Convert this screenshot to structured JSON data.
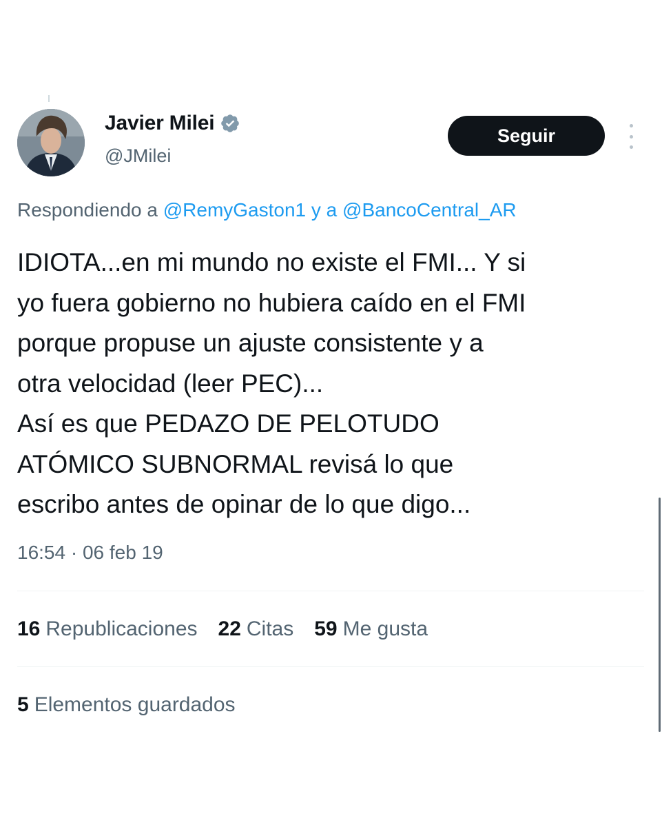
{
  "author": {
    "display_name": "Javier Milei",
    "handle": "@JMilei",
    "verified_color": "#829aab"
  },
  "actions": {
    "follow_label": "Seguir",
    "more_icon": "more-vertical-icon"
  },
  "reply_context": {
    "prefix": "Respondiendo a ",
    "mention_1": "@RemyGaston1",
    "joiner": " y a ",
    "mention_2": "@BancoCentral_AR"
  },
  "tweet": {
    "text": "IDIOTA...en mi mundo no existe el FMI... Y si\nyo fuera gobierno no hubiera caído en el FMI\nporque propuse un ajuste consistente y a\notra velocidad (leer PEC)...\nAsí es que PEDAZO DE PELOTUDO\nATÓMICO SUBNORMAL revisá lo que\nescribo antes de opinar de lo que digo...",
    "timestamp": "16:54 · 06 feb 19"
  },
  "stats": {
    "reposts_count": "16",
    "reposts_label": "Republicaciones",
    "quotes_count": "22",
    "quotes_label": "Citas",
    "likes_count": "59",
    "likes_label": "Me gusta",
    "bookmarks_count": "5",
    "bookmarks_label": "Elementos guardados"
  },
  "colors": {
    "text_primary": "#0f1419",
    "text_secondary": "#536471",
    "link": "#1d9bf0",
    "button_bg": "#0f1419"
  }
}
